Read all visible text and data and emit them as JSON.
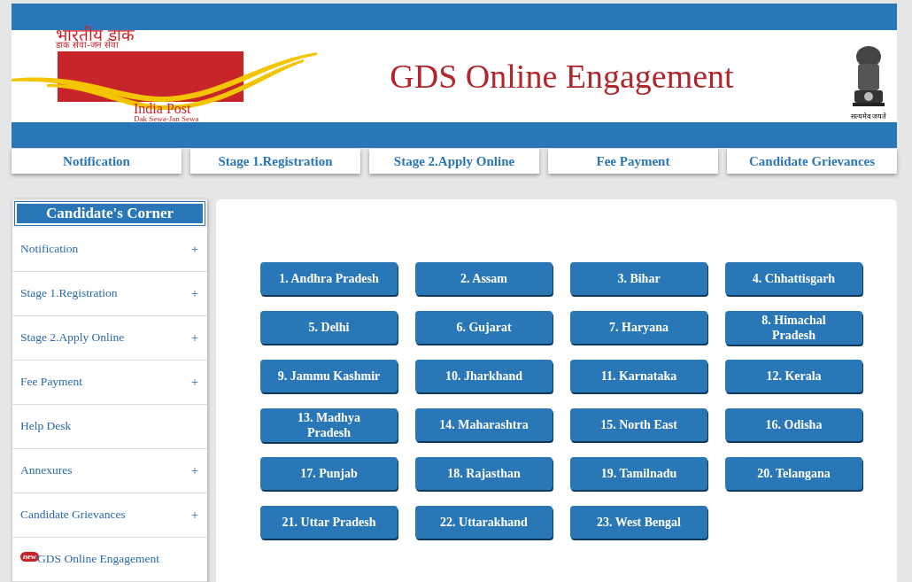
{
  "logo": {
    "hindi_title": "भारतीय डाक",
    "hindi_tagline": "डाक सेवा-जन सेवा",
    "name": "India Post",
    "tagline": "Dak Sewa-Jan Sewa"
  },
  "title": "GDS Online Engagement",
  "emblem": {
    "motto": "सत्यमेव जयते"
  },
  "nav": [
    "Notification",
    "Stage 1.Registration",
    "Stage 2.Apply Online",
    "Fee Payment",
    "Candidate Grievances"
  ],
  "sidebar": {
    "title": "Candidate's Corner",
    "items": [
      {
        "label": "Notification",
        "expandable": true,
        "new": false
      },
      {
        "label": "Stage 1.Registration",
        "expandable": true,
        "new": false
      },
      {
        "label": "Stage 2.Apply Online",
        "expandable": true,
        "new": false
      },
      {
        "label": "Fee Payment",
        "expandable": true,
        "new": false
      },
      {
        "label": "Help Desk",
        "expandable": false,
        "new": false
      },
      {
        "label": "Annexures",
        "expandable": true,
        "new": false
      },
      {
        "label": "Candidate Grievances",
        "expandable": true,
        "new": false
      },
      {
        "label": "GDS Online Engagement",
        "expandable": false,
        "new": true,
        "badge": "new"
      }
    ],
    "expand_symbol": "+"
  },
  "states": [
    "1. Andhra Pradesh",
    "2. Assam",
    "3. Bihar",
    "4. Chhattisgarh",
    "5. Delhi",
    "6. Gujarat",
    "7. Haryana",
    "8. Himachal Pradesh",
    "9. Jammu Kashmir",
    "10. Jharkhand",
    "11. Karnataka",
    "12. Kerala",
    "13. Madhya Pradesh",
    "14. Maharashtra",
    "15. North East",
    "16. Odisha",
    "17. Punjab",
    "18. Rajasthan",
    "19. Tamilnadu",
    "20. Telangana",
    "21. Uttar Pradesh",
    "22. Uttarakhand",
    "23. West Bengal"
  ]
}
